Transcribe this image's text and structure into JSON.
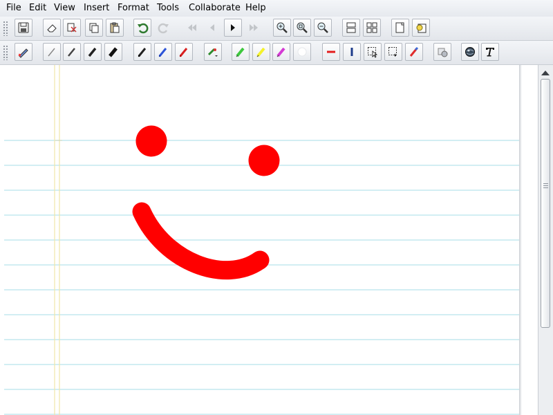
{
  "menu": {
    "items": [
      {
        "id": "file",
        "label": "File"
      },
      {
        "id": "edit",
        "label": "Edit"
      },
      {
        "id": "view",
        "label": "View"
      },
      {
        "id": "insert",
        "label": "Insert"
      },
      {
        "id": "format",
        "label": "Format"
      },
      {
        "id": "tools",
        "label": "Tools"
      },
      {
        "id": "collaborate",
        "label": "Collaborate"
      },
      {
        "id": "help",
        "label": "Help"
      }
    ]
  },
  "toolbar_top": {
    "buttons": [
      {
        "name": "save-button",
        "icon": "floppy-disk-icon"
      },
      {
        "name": "clear-page-button",
        "icon": "eraser-icon"
      },
      {
        "name": "cut-button",
        "icon": "scissors-icon"
      },
      {
        "name": "copy-button",
        "icon": "copy-icon"
      },
      {
        "name": "paste-button",
        "icon": "clipboard-icon"
      },
      {
        "name": "undo-button",
        "icon": "undo-arrow-icon"
      },
      {
        "name": "redo-button",
        "icon": "redo-arrow-icon",
        "disabled": true
      },
      {
        "name": "first-page-button",
        "icon": "double-left-icon",
        "disabled": true
      },
      {
        "name": "previous-page-button",
        "icon": "left-triangle-icon",
        "disabled": true
      },
      {
        "name": "next-page-button",
        "icon": "right-triangle-icon"
      },
      {
        "name": "last-page-button",
        "icon": "double-right-icon",
        "disabled": true
      },
      {
        "name": "zoom-in-button",
        "icon": "magnifier-plus-icon"
      },
      {
        "name": "zoom-fit-button",
        "icon": "magnifier-fit-icon"
      },
      {
        "name": "zoom-out-button",
        "icon": "magnifier-minus-icon"
      },
      {
        "name": "page-view-button",
        "icon": "two-rows-icon"
      },
      {
        "name": "thumbnails-button",
        "icon": "grid-icon"
      },
      {
        "name": "new-page-button",
        "icon": "new-page-icon"
      },
      {
        "name": "insert-image-button",
        "icon": "image-insert-icon"
      }
    ]
  },
  "toolbar_bottom": {
    "buttons": [
      {
        "name": "pen-select-button",
        "icon": "pen-color-icon"
      },
      {
        "name": "pencil-fine-button",
        "icon": "pencil-fine-icon"
      },
      {
        "name": "pencil-medium-button",
        "icon": "pencil-medium-icon"
      },
      {
        "name": "pencil-thick-button",
        "icon": "pencil-thick-icon"
      },
      {
        "name": "pencil-extra-button",
        "icon": "pencil-extra-icon"
      },
      {
        "name": "pen-black-button",
        "icon": "black-pen-icon"
      },
      {
        "name": "pen-blue-button",
        "icon": "blue-pen-icon"
      },
      {
        "name": "pen-red-button",
        "icon": "red-pen-icon"
      },
      {
        "name": "pen-color-menu-button",
        "icon": "pen-color-dropdown-icon"
      },
      {
        "name": "highlighter-green-button",
        "icon": "green-highlighter-icon"
      },
      {
        "name": "highlighter-yellow-button",
        "icon": "yellow-highlighter-icon"
      },
      {
        "name": "highlighter-magenta-button",
        "icon": "magenta-highlighter-icon"
      },
      {
        "name": "highlighter-white-button",
        "icon": "white-circle-icon"
      },
      {
        "name": "line-style-red-button",
        "icon": "red-dash-icon"
      },
      {
        "name": "line-style-blue-button",
        "icon": "blue-bar-icon"
      },
      {
        "name": "lasso-select-button",
        "icon": "lasso-select-icon"
      },
      {
        "name": "rect-select-button",
        "icon": "rect-select-icon"
      },
      {
        "name": "stroke-eraser-button",
        "icon": "stroke-eraser-icon"
      },
      {
        "name": "screen-capture-button",
        "icon": "camera-icon"
      },
      {
        "name": "shapes-button",
        "icon": "globe-icon"
      },
      {
        "name": "text-tool-button",
        "icon": "text-t-icon"
      }
    ]
  },
  "canvas": {
    "paper": "ruled",
    "rule_color": "#b7e3ec",
    "margin_color": "#f2e6a0",
    "ink_color": "#ff0000"
  }
}
